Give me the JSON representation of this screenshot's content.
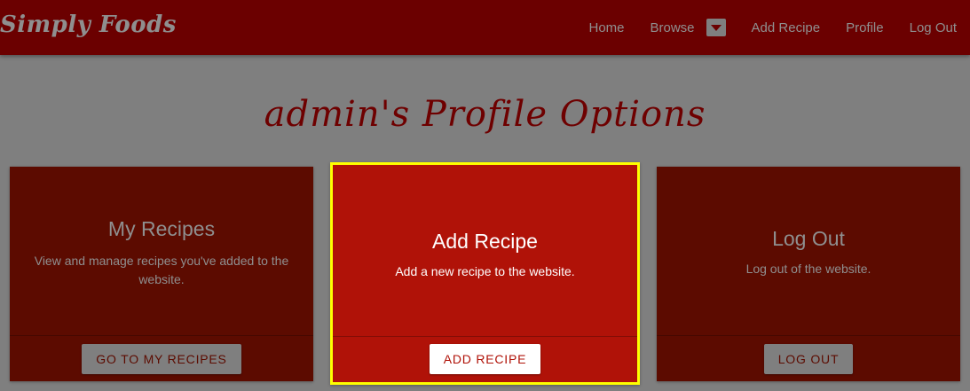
{
  "navbar": {
    "brand": "Simply Foods",
    "links": {
      "home": "Home",
      "browse": "Browse",
      "add_recipe": "Add Recipe",
      "profile": "Profile",
      "log_out": "Log Out"
    },
    "browse_dropdown_icon": "caret-down-icon"
  },
  "page": {
    "title": "admin's Profile Options"
  },
  "cards": {
    "my_recipes": {
      "title": "My Recipes",
      "text": "View and manage recipes you've added to the website.",
      "button": "GO TO MY RECIPES"
    },
    "add_recipe": {
      "title": "Add Recipe",
      "text": "Add a new recipe to the website.",
      "button": "ADD RECIPE"
    },
    "log_out": {
      "title": "Log Out",
      "text": "Log out of the website.",
      "button": "LOG OUT"
    }
  },
  "colors": {
    "navbar_bg": "#6b0000",
    "page_bg": "#7f7f7f",
    "card_bg": "#5c0b00",
    "highlight_card_bg": "#b01208",
    "highlight_border": "#ffff00"
  }
}
